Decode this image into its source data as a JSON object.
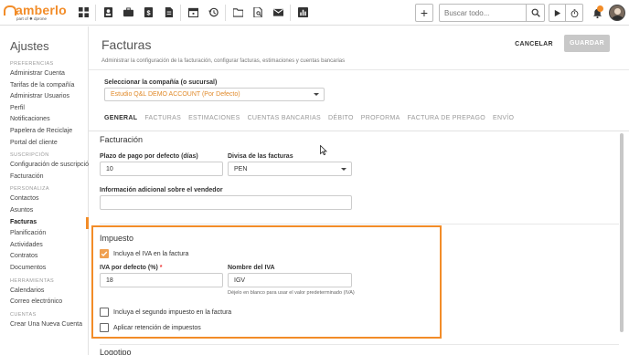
{
  "brand": {
    "name": "amberlo",
    "tagline": "part of ✹ dprone",
    "accent": "#f28c28"
  },
  "topbar": {
    "icons": [
      "apps-grid-icon",
      "contacts-card-icon",
      "briefcase-icon",
      "invoice-dollar-icon",
      "document-icon",
      "calendar-icon",
      "history-icon",
      "folder-icon",
      "file-search-icon",
      "mail-icon",
      "bar-chart-icon"
    ],
    "add_label": "+",
    "search_placeholder": "Buscar todo..."
  },
  "sidebar": {
    "title": "Ajustes",
    "sections": [
      {
        "label": "PREFERENCIAS",
        "items": [
          "Administrar Cuenta",
          "Tarifas de la compañía",
          "Administrar Usuarios",
          "Perfil",
          "Notificaciones",
          "Papelera de Reciclaje",
          "Portal del cliente"
        ]
      },
      {
        "label": "SUSCRIPCIÓN",
        "items": [
          "Configuración de suscripción",
          "Facturación"
        ]
      },
      {
        "label": "PERSONALIZA",
        "items": [
          "Contactos",
          "Asuntos",
          "Facturas",
          "Planificación",
          "Actividades",
          "Contratos",
          "Documentos"
        ]
      },
      {
        "label": "HERRAMIENTAS",
        "items": [
          "Calendarios",
          "Correo electrónico"
        ]
      },
      {
        "label": "CUENTAS",
        "items": [
          "Crear Una Nueva Cuenta"
        ]
      }
    ],
    "active_item": "Facturas"
  },
  "header": {
    "title": "Facturas",
    "subtitle": "Administrar la configuración de la facturación, configurar facturas, estimaciones y cuentas bancarias",
    "cancel_label": "CANCELAR",
    "save_label": "GUARDAR"
  },
  "company": {
    "label": "Seleccionar la compañía (o sucursal)",
    "value": "Estudio Q&L DEMO ACCOUNT (Por Defecto)"
  },
  "tabs": [
    "GENERAL",
    "FACTURAS",
    "ESTIMACIONES",
    "CUENTAS BANCARIAS",
    "DÉBITO",
    "PROFORMA",
    "FACTURA DE PREPAGO",
    "ENVÍO"
  ],
  "active_tab": "GENERAL",
  "facturacion": {
    "title": "Facturación",
    "plazo_label": "Plazo de pago por defecto (días)",
    "plazo_value": "10",
    "divisa_label": "Divisa de las facturas",
    "divisa_value": "PEN",
    "info_label": "Información adicional sobre el vendedor",
    "info_value": ""
  },
  "impuesto": {
    "title": "Impuesto",
    "incluye_iva_label": "Incluya el IVA en la factura",
    "incluye_iva_checked": true,
    "iva_label": "IVA por defecto (%)",
    "iva_required_mark": "*",
    "iva_value": "18",
    "nombre_label": "Nombre del IVA",
    "nombre_value": "IGV",
    "nombre_hint": "Déjelo en blanco para usar el valor predeterminado (IVA)",
    "segundo_label": "Incluya el segundo impuesto en la factura",
    "segundo_checked": false,
    "retencion_label": "Aplicar retención de impuestos",
    "retencion_checked": false
  },
  "logotipo": {
    "title": "Logotipo"
  }
}
